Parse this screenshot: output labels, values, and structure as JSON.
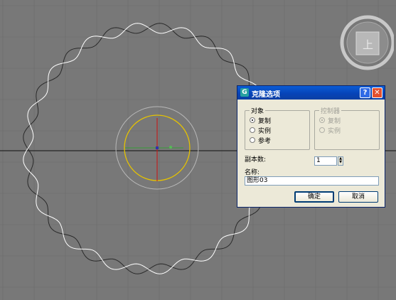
{
  "viewport": {
    "colors": {
      "background": "#787878",
      "grid": "#6c6c6c",
      "spline_white": "#ffffff",
      "spline_dark": "#2a2a2a",
      "circle": "#e6c300",
      "axis_x": "#111111",
      "axis_y": "#cc1111",
      "axis_z": "#22aa22"
    }
  },
  "viewcube": {
    "face_label": "上",
    "icon": "viewcube-icon"
  },
  "dialog": {
    "title": "克隆选项",
    "help_label": "?",
    "close_label": "✕",
    "object_group": {
      "label": "对象",
      "options": [
        {
          "label": "复制",
          "checked": true
        },
        {
          "label": "实例",
          "checked": false
        },
        {
          "label": "参考",
          "checked": false
        }
      ]
    },
    "controller_group": {
      "label": "控制器",
      "options": [
        {
          "label": "复制",
          "checked": true
        },
        {
          "label": "实例",
          "checked": false
        }
      ]
    },
    "copies": {
      "label": "副本数:",
      "value": "1"
    },
    "name": {
      "label": "名称:",
      "value": "图形03"
    },
    "ok_label": "确定",
    "cancel_label": "取消"
  }
}
